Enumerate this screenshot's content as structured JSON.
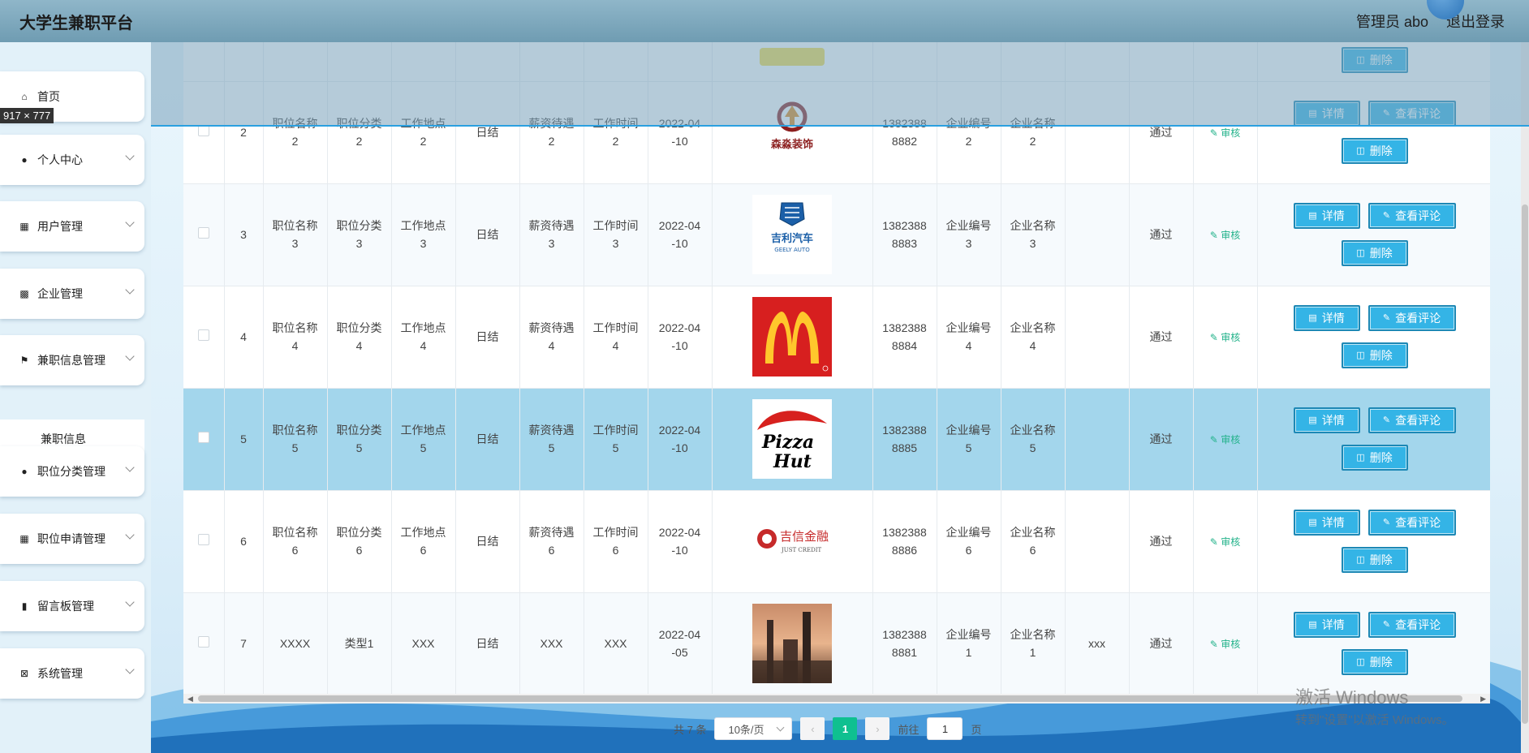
{
  "header": {
    "brand": "大学生兼职平台",
    "admin_label": "管理员 abo",
    "logout_label": "退出登录"
  },
  "size_tip": "917 × 777",
  "sidebar": {
    "items": [
      {
        "label": "首页",
        "icon": "home-icon"
      },
      {
        "label": "个人中心",
        "icon": "user-icon"
      },
      {
        "label": "用户管理",
        "icon": "grid-icon"
      },
      {
        "label": "企业管理",
        "icon": "clipboard-icon"
      },
      {
        "label": "兼职信息管理",
        "icon": "flag-icon"
      },
      {
        "label": "职位分类管理",
        "icon": "bulb-icon"
      },
      {
        "label": "职位申请管理",
        "icon": "grid-icon"
      },
      {
        "label": "留言板管理",
        "icon": "bar-chart-icon"
      },
      {
        "label": "系统管理",
        "icon": "x-box-icon"
      }
    ],
    "sub_item": "兼职信息"
  },
  "table": {
    "rows": [
      {
        "no": "2",
        "name": "职位名称2",
        "category": "职位分类2",
        "location": "工作地点2",
        "settle": "日结",
        "salary": "薪资待遇2",
        "worktime": "工作时间2",
        "date": "2022-04-10",
        "logo": "森淼装饰",
        "phone": "13823888882",
        "ent_no": "企业编号2",
        "ent_name": "企业名称2",
        "remark": "",
        "status": "通过",
        "audit": "审核"
      },
      {
        "no": "3",
        "name": "职位名称3",
        "category": "职位分类3",
        "location": "工作地点3",
        "settle": "日结",
        "salary": "薪资待遇3",
        "worktime": "工作时间3",
        "date": "2022-04-10",
        "logo": "吉利汽车",
        "phone": "13823888883",
        "ent_no": "企业编号3",
        "ent_name": "企业名称3",
        "remark": "",
        "status": "通过",
        "audit": "审核"
      },
      {
        "no": "4",
        "name": "职位名称4",
        "category": "职位分类4",
        "location": "工作地点4",
        "settle": "日结",
        "salary": "薪资待遇4",
        "worktime": "工作时间4",
        "date": "2022-04-10",
        "logo": "mcdonalds",
        "phone": "13823888884",
        "ent_no": "企业编号4",
        "ent_name": "企业名称4",
        "remark": "",
        "status": "通过",
        "audit": "审核"
      },
      {
        "no": "5",
        "name": "职位名称5",
        "category": "职位分类5",
        "location": "工作地点5",
        "settle": "日结",
        "salary": "薪资待遇5",
        "worktime": "工作时间5",
        "date": "2022-04-10",
        "logo": "pizzahut",
        "phone": "13823888885",
        "ent_no": "企业编号5",
        "ent_name": "企业名称5",
        "remark": "",
        "status": "通过",
        "audit": "审核"
      },
      {
        "no": "6",
        "name": "职位名称6",
        "category": "职位分类6",
        "location": "工作地点6",
        "settle": "日结",
        "salary": "薪资待遇6",
        "worktime": "工作时间6",
        "date": "2022-04-10",
        "logo": "吉信金融",
        "phone": "13823888886",
        "ent_no": "企业编号6",
        "ent_name": "企业名称6",
        "remark": "",
        "status": "通过",
        "audit": "审核"
      },
      {
        "no": "7",
        "name": "XXXX",
        "category": "类型1",
        "location": "XXX",
        "settle": "日结",
        "salary": "XXX",
        "worktime": "XXX",
        "date": "2022-04-05",
        "logo": "city-photo",
        "phone": "13823888881",
        "ent_no": "企业编号1",
        "ent_name": "企业名称1",
        "remark": "xxx",
        "status": "通过",
        "audit": "审核"
      }
    ],
    "buttons": {
      "detail": "详情",
      "review": "查看评论",
      "delete": "删除"
    },
    "logo_texts": {
      "senmiao": "森淼装饰",
      "geely": "吉利汽车",
      "geely_en": "GEELY AUTO",
      "pizza1": "Pizza",
      "pizza2": "Hut",
      "jixin": "吉信金融",
      "jixin_en": "JUST CREDIT"
    }
  },
  "pagination": {
    "total": "共 7 条",
    "page_size": "10条/页",
    "current": "1",
    "goto_prefix": "前往",
    "goto_value": "1",
    "goto_suffix": "页"
  },
  "watermark": {
    "line1": "激活 Windows",
    "line2": "转到\"设置\"以激活 Windows。"
  },
  "colors": {
    "header_bg": "#7ea9bf",
    "button_bg": "#34b4e6",
    "selected_row": "#a3d6ec",
    "pager_active": "#0fc090",
    "audit_text": "#22b28a"
  }
}
